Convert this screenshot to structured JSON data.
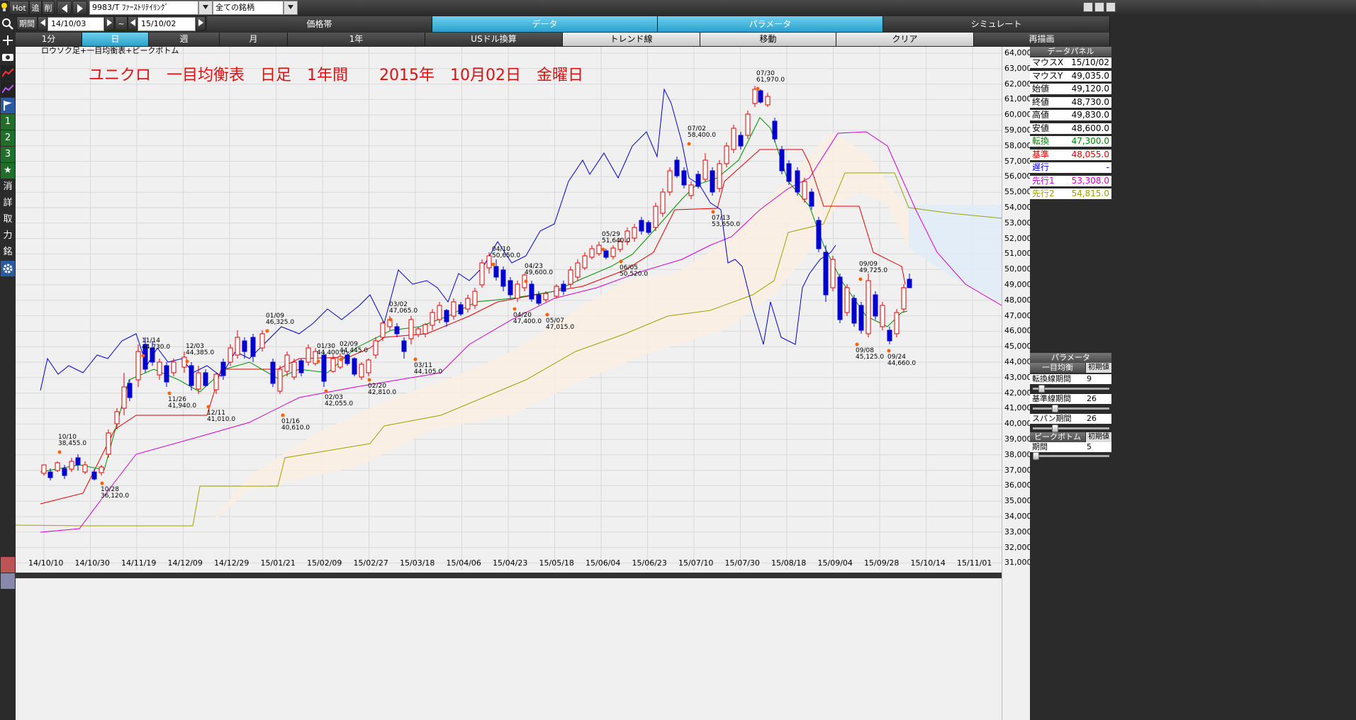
{
  "toolbar": {
    "hot": "Hot",
    "add": "追",
    "del": "削",
    "symbol": "9983/T ﾌｧｰｽﾄﾘﾃｲﾘﾝｸﾞ",
    "universe": "全ての銘柄"
  },
  "period_row": {
    "label": "期間",
    "from": "14/10/03",
    "tilde": "~",
    "to": "15/10/02"
  },
  "tabs": [
    {
      "label": "価格帯"
    },
    {
      "label": "データ"
    },
    {
      "label": "パラメータ"
    },
    {
      "label": "シミュレート"
    }
  ],
  "subtabs": [
    {
      "label": "1分"
    },
    {
      "label": "日"
    },
    {
      "label": "週"
    },
    {
      "label": "月"
    },
    {
      "label": "1年"
    },
    {
      "label": "USドル換算"
    },
    {
      "label": "トレンド線"
    },
    {
      "label": "移動"
    },
    {
      "label": "クリア"
    },
    {
      "label": "再描画"
    }
  ],
  "left_tools": [
    "search-icon",
    "plus-icon",
    "camera-icon",
    "chart-icon",
    "chart-icon",
    "flag-icon",
    "1",
    "2",
    "3",
    "★",
    "消",
    "詳",
    "取",
    "力",
    "銘",
    "gear-icon"
  ],
  "chart": {
    "indicator_label": "ロウソク足+一目均衡表+ピークボトム",
    "title": "ユニクロ　一目均衡表　日足　1年間　　2015年　10月02日　金曜日"
  },
  "chart_data": {
    "type": "candlestick",
    "y_ticks": [
      31000,
      32000,
      33000,
      34000,
      35000,
      36000,
      37000,
      38000,
      39000,
      40000,
      41000,
      42000,
      43000,
      44000,
      45000,
      46000,
      47000,
      48000,
      49000,
      50000,
      51000,
      52000,
      53000,
      54000,
      55000,
      56000,
      57000,
      58000,
      59000,
      60000,
      61000,
      62000,
      63000,
      64000
    ],
    "y_tick_labels": [
      "31,000",
      "32,000",
      "33,000",
      "34,000",
      "35,000",
      "36,000",
      "37,000",
      "38,000",
      "39,000",
      "40,000",
      "41,000",
      "42,000",
      "43,000",
      "44,000",
      "45,000",
      "46,000",
      "47,000",
      "48,000",
      "49,000",
      "50,000",
      "51,000",
      "52,000",
      "53,000",
      "54,000",
      "55,000",
      "56,000",
      "57,000",
      "58,000",
      "59,000",
      "60,000",
      "61,000",
      "62,000",
      "63,000",
      "64,000"
    ],
    "x_tick_labels": [
      "14/10/10",
      "14/10/30",
      "14/11/19",
      "14/12/09",
      "14/12/29",
      "15/01/21",
      "15/02/09",
      "15/02/27",
      "15/03/18",
      "15/04/06",
      "15/04/23",
      "15/05/18",
      "15/06/04",
      "15/06/23",
      "15/07/10",
      "15/07/30",
      "15/08/18",
      "15/09/04",
      "15/09/28",
      "15/10/14",
      "15/11/01"
    ],
    "peaks": [
      {
        "date": "10/10",
        "price": "38,455.0"
      },
      {
        "date": "10/28",
        "price": "36,120.0"
      },
      {
        "date": "11/14",
        "price": "44,730.0"
      },
      {
        "date": "11/26",
        "price": "41,940.0"
      },
      {
        "date": "12/03",
        "price": "44,385.0"
      },
      {
        "date": "12/11",
        "price": "41,010.0"
      },
      {
        "date": "01/09",
        "price": "46,325.0"
      },
      {
        "date": "01/16",
        "price": "40,610.0"
      },
      {
        "date": "01/30",
        "price": "44,400.0"
      },
      {
        "date": "02/03",
        "price": "42,055.0"
      },
      {
        "date": "02/09",
        "price": "44,445.0"
      },
      {
        "date": "02/20",
        "price": "42,810.0"
      },
      {
        "date": "03/02",
        "price": "47,065.0"
      },
      {
        "date": "03/11",
        "price": "44,105.0"
      },
      {
        "date": "04/10",
        "price": "50,650.0"
      },
      {
        "date": "04/20",
        "price": "47,400.0"
      },
      {
        "date": "04/23",
        "price": "49,600.0"
      },
      {
        "date": "05/07",
        "price": "47,015.0"
      },
      {
        "date": "05/29",
        "price": "51,640.0"
      },
      {
        "date": "06/05",
        "price": "50,520.0"
      },
      {
        "date": "07/02",
        "price": "58,400.0"
      },
      {
        "date": "07/13",
        "price": "53,650.0"
      },
      {
        "date": "07/30",
        "price": "61,970.0"
      },
      {
        "date": "09/08",
        "price": "45,125.0"
      },
      {
        "date": "09/09",
        "price": "49,725.0"
      },
      {
        "date": "09/24",
        "price": "44,660.0"
      }
    ],
    "last_candle": {
      "open": 49120,
      "close": 48730,
      "high": 49830,
      "low": 48600
    },
    "lines": {
      "tenkan": 47300,
      "kijun": 48055,
      "senkou1": 53308,
      "senkou2": 54815
    }
  },
  "data_panel": {
    "title": "データパネル",
    "rows": [
      {
        "label": "マウスX",
        "value": "15/10/02",
        "color": "#000000"
      },
      {
        "label": "マウスY",
        "value": "49,035.0",
        "color": "#000000"
      },
      {
        "label": "始値",
        "value": "49,120.0",
        "color": "#000000"
      },
      {
        "label": "終値",
        "value": "48,730.0",
        "color": "#000000"
      },
      {
        "label": "高値",
        "value": "49,830.0",
        "color": "#000000"
      },
      {
        "label": "安値",
        "value": "48,600.0",
        "color": "#000000"
      },
      {
        "label": "転換",
        "value": "47,300.0",
        "color": "#008000"
      },
      {
        "label": "基準",
        "value": "48,055.0",
        "color": "#e00000"
      },
      {
        "label": "遅行",
        "value": "-",
        "color": "#0000e0"
      },
      {
        "label": "先行1",
        "value": "53,308.0",
        "color": "#d000d0"
      },
      {
        "label": "先行2",
        "value": "54,815.0",
        "color": "#a0a000"
      }
    ]
  },
  "param_panel": {
    "title": "パラメータ",
    "ichimoku": "一目均衡",
    "initial": "初期値",
    "tenkan_label": "転換線期間",
    "tenkan_value": "9",
    "kijun_label": "基準線期間",
    "kijun_value": "26",
    "span_label": "スパン期間",
    "span_value": "26",
    "peak_title": "ピークボトム",
    "peak_label": "期間",
    "peak_value": "5"
  }
}
